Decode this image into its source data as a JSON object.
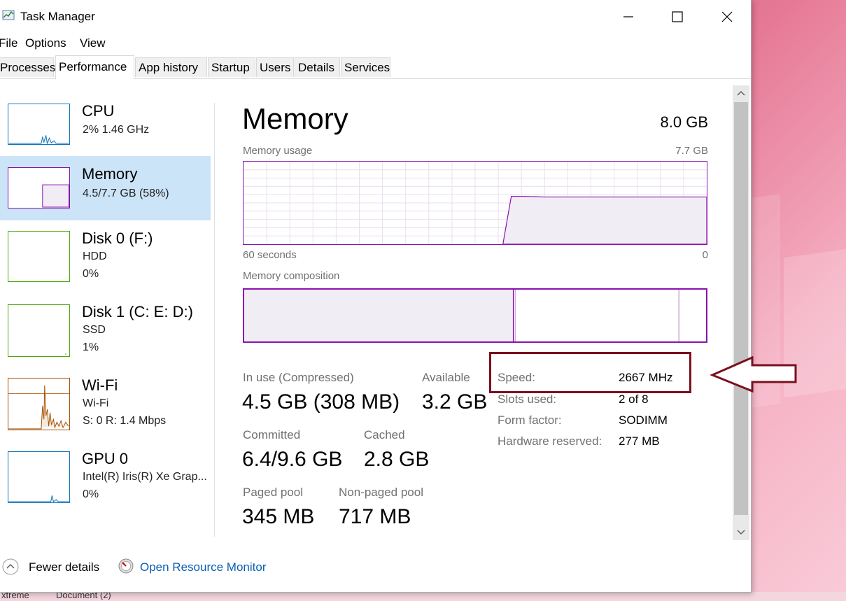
{
  "window": {
    "title": "Task Manager"
  },
  "menu": [
    "File",
    "Options",
    "View"
  ],
  "tabs": [
    "Processes",
    "Performance",
    "App history",
    "Startup",
    "Users",
    "Details",
    "Services"
  ],
  "active_tab": "Performance",
  "sidebar": [
    {
      "title": "CPU",
      "sub1": "2%  1.46 GHz",
      "sub2": "",
      "color": "#1175b8"
    },
    {
      "title": "Memory",
      "sub1": "4.5/7.7 GB (58%)",
      "sub2": "",
      "color": "#8b12ae"
    },
    {
      "title": "Disk 0 (F:)",
      "sub1": "HDD",
      "sub2": "0%",
      "color": "#4da60c"
    },
    {
      "title": "Disk 1 (C: E: D:)",
      "sub1": "SSD",
      "sub2": "1%",
      "color": "#4da60c"
    },
    {
      "title": "Wi-Fi",
      "sub1": "Wi-Fi",
      "sub2": "S: 0  R: 1.4 Mbps",
      "color": "#a74f01"
    },
    {
      "title": "GPU 0",
      "sub1": "Intel(R) Iris(R) Xe Grap...",
      "sub2": "0%",
      "color": "#1175b8"
    }
  ],
  "main": {
    "title": "Memory",
    "total": "8.0 GB",
    "usage_label": "Memory usage",
    "usage_max": "7.7 GB",
    "time_left": "60 seconds",
    "time_right": "0",
    "usage_fraction_current": 0.58,
    "composition_label": "Memory composition"
  },
  "stats": {
    "in_use_label": "In use (Compressed)",
    "in_use_value": "4.5 GB (308 MB)",
    "available_label": "Available",
    "available_value": "3.2 GB",
    "committed_label": "Committed",
    "committed_value": "6.4/9.6 GB",
    "cached_label": "Cached",
    "cached_value": "2.8 GB",
    "paged_label": "Paged pool",
    "paged_value": "345 MB",
    "nonpaged_label": "Non-paged pool",
    "nonpaged_value": "717 MB"
  },
  "details": [
    {
      "label": "Speed:",
      "value": "2667 MHz"
    },
    {
      "label": "Slots used:",
      "value": "2 of 8"
    },
    {
      "label": "Form factor:",
      "value": "SODIMM"
    },
    {
      "label": "Hardware reserved:",
      "value": "277 MB"
    }
  ],
  "footer": {
    "fewer_details": "Fewer details",
    "open_resource_monitor": "Open Resource Monitor"
  },
  "taskbar": [
    "xtreme",
    "Document (2)"
  ],
  "colors": {
    "memory_accent": "#8b12ae",
    "highlight": "#7b1020",
    "link": "#0a5fb4",
    "selected_bg": "#cce4f7"
  }
}
